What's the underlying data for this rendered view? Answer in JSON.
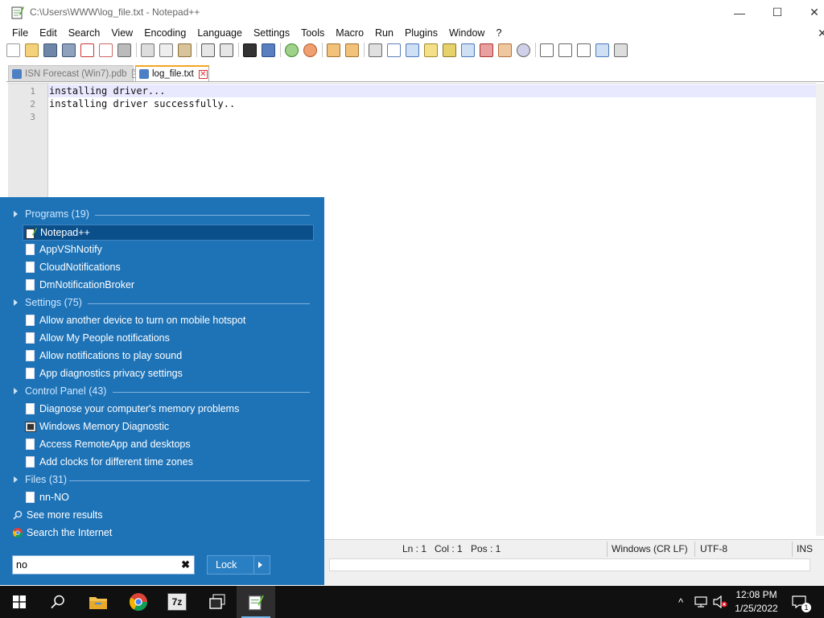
{
  "window": {
    "title": "C:\\Users\\WWW\\log_file.txt - Notepad++",
    "minimize": "—",
    "maximize": "☐",
    "close": "✕"
  },
  "menu": {
    "items": [
      "File",
      "Edit",
      "Search",
      "View",
      "Encoding",
      "Language",
      "Settings",
      "Tools",
      "Macro",
      "Run",
      "Plugins",
      "Window",
      "?"
    ],
    "close_glyph": "✕"
  },
  "tabs": [
    {
      "label": "ISN Forecast (Win7).pdb",
      "active": false
    },
    {
      "label": "log_file.txt",
      "active": true
    }
  ],
  "editor": {
    "line_numbers": [
      "1",
      "2",
      "3"
    ],
    "lines": [
      "installing driver...",
      "installing driver successfully..",
      ""
    ]
  },
  "status": {
    "ln": "Ln : 1",
    "col": "Col : 1",
    "pos": "Pos : 1",
    "eol": "Windows (CR LF)",
    "encoding": "UTF-8",
    "mode": "INS"
  },
  "start_menu": {
    "groups": {
      "programs": "Programs (19)",
      "settings": "Settings (75)",
      "control_panel": "Control Panel (43)",
      "files": "Files (31)"
    },
    "programs": [
      "Notepad++",
      "AppVShNotify",
      "CloudNotifications",
      "DmNotificationBroker"
    ],
    "settings": [
      "Allow another device to turn on mobile hotspot",
      "Allow My People notifications",
      "Allow notifications to play sound",
      "App diagnostics privacy settings"
    ],
    "control_panel": [
      "Diagnose your computer's memory problems",
      "Windows Memory Diagnostic",
      "Access RemoteApp and desktops",
      "Add clocks for different time zones"
    ],
    "files": [
      "nn-NO"
    ],
    "see_more": "See more results",
    "search_internet": "Search the Internet",
    "search_value": "no",
    "lock_label": "Lock",
    "clear_glyph": "✖"
  },
  "taskbar": {
    "seven_zip_label": "7z",
    "time": "12:08 PM",
    "date": "1/25/2022",
    "tray_chevron": "^",
    "notification_count": "1"
  },
  "colors": {
    "start_menu_bg": "#1e73b7",
    "selected_item_bg": "#0b4f8a",
    "taskbar_bg": "#101010",
    "current_line_bg": "#e8e8ff"
  }
}
